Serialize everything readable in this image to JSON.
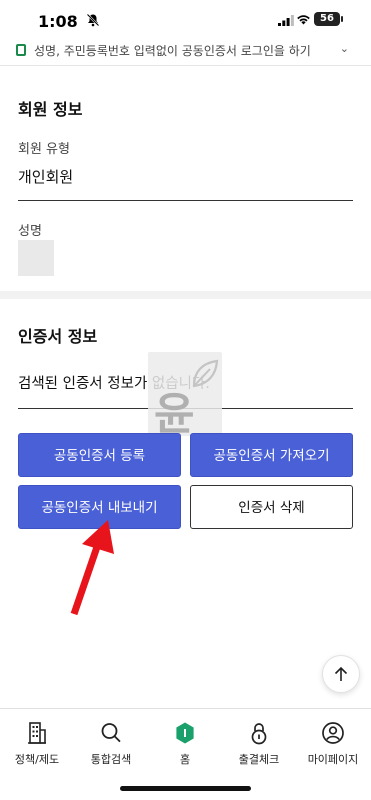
{
  "status_bar": {
    "time": "1:08",
    "battery": "56"
  },
  "notice": {
    "text": "성명, 주민등록번호 입력없이 공동인증서 로그인을 하기"
  },
  "member_info": {
    "title": "회원 정보",
    "type_label": "회원 유형",
    "type_value": "개인회원",
    "name_label": "성명"
  },
  "cert_info": {
    "title": "인증서 정보",
    "status_text": "검색된 인증서 정보가 없습니다."
  },
  "buttons": {
    "register": "공동인증서 등록",
    "import": "공동인증서 가져오기",
    "export": "공동인증서 내보내기",
    "delete": "인증서 삭제"
  },
  "watermark": {
    "char": "윤"
  },
  "bottom_nav": [
    {
      "label": "정책/제도",
      "icon": "building-icon"
    },
    {
      "label": "통합검색",
      "icon": "search-icon"
    },
    {
      "label": "홈",
      "icon": "home-icon"
    },
    {
      "label": "출결체크",
      "icon": "lock-icon"
    },
    {
      "label": "마이페이지",
      "icon": "user-icon"
    }
  ],
  "colors": {
    "primary": "#4a60d6",
    "accent_green": "#1aa06a",
    "annotation_arrow": "#e8141c"
  }
}
